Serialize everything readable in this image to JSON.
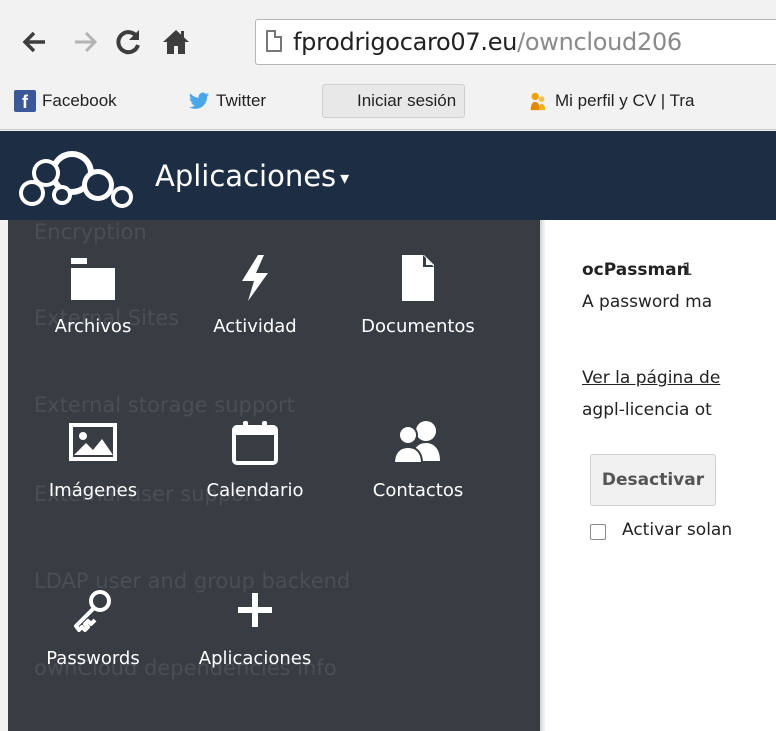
{
  "browser": {
    "url_domain": "fprodrigocaro07.eu",
    "url_path": "/owncloud206"
  },
  "bookmarks": [
    {
      "label": "Facebook",
      "icon": "facebook-icon"
    },
    {
      "label": "Twitter",
      "icon": "twitter-icon"
    },
    {
      "label": "Iniciar sesión",
      "icon": "microsoft-icon"
    },
    {
      "label": "Mi perfil y CV | Tra",
      "icon": "profile-icon"
    }
  ],
  "header": {
    "app_menu_label": "Aplicaciones",
    "caret": "▾"
  },
  "apps_menu": {
    "items": [
      {
        "label": "Archivos",
        "icon": "folder-icon"
      },
      {
        "label": "Actividad",
        "icon": "lightning-icon"
      },
      {
        "label": "Documentos",
        "icon": "document-icon"
      },
      {
        "label": "Imágenes",
        "icon": "image-icon"
      },
      {
        "label": "Calendario",
        "icon": "calendar-icon"
      },
      {
        "label": "Contactos",
        "icon": "contacts-icon"
      },
      {
        "label": "Passwords",
        "icon": "key-icon"
      },
      {
        "label": "Aplicaciones",
        "icon": "plus-icon"
      }
    ],
    "background_list": [
      "Encryption",
      "External Sites",
      "External storage support",
      "External user support",
      "LDAP user and group backend",
      "ownCloud dependencies info"
    ]
  },
  "app_detail": {
    "name": "ocPassman",
    "version": "1",
    "description": "A password ma",
    "link_text": "Ver la página de",
    "license": "agpl-licencia ot",
    "deactivate_label": "Desactivar",
    "checkbox_label": "Activar solan"
  },
  "colors": {
    "header_bg": "#1d2d44",
    "menu_bg": "#383c43",
    "content_bg": "#ffffff"
  }
}
